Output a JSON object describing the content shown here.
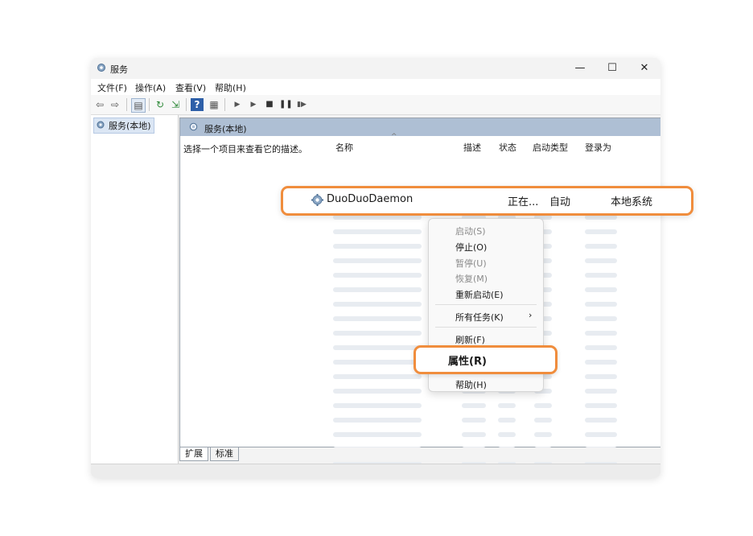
{
  "window": {
    "title": "服务",
    "minimize": "—",
    "maximize": "☐",
    "close": "✕"
  },
  "menu": [
    "文件(F)",
    "操作(A)",
    "查看(V)",
    "帮助(H)"
  ],
  "tree": {
    "item": "服务(本地)"
  },
  "pane": {
    "header": "服务(本地)",
    "description_hint": "选择一个项目来查看它的描述。",
    "columns": [
      "名称",
      "描述",
      "状态",
      "启动类型",
      "登录为"
    ]
  },
  "highlighted_service": {
    "name": "DuoDuoDaemon",
    "status": "正在...",
    "startup": "自动",
    "logon": "本地系统"
  },
  "context_menu": {
    "start": "启动(S)",
    "stop": "停止(O)",
    "pause": "暂停(U)",
    "resume": "恢复(M)",
    "restart": "重新启动(E)",
    "all_tasks": "所有任务(K)",
    "all_tasks_arrow": "›",
    "refresh": "刷新(F)",
    "properties": "属性(R)",
    "help": "帮助(H)"
  },
  "tabs": [
    "扩展",
    "标准"
  ],
  "toolbar_icons": [
    "back-arrow-icon",
    "forward-arrow-icon",
    "show-hide-tree-icon",
    "refresh-icon",
    "export-icon",
    "help-icon",
    "properties-icon",
    "play-icon",
    "play-alt-icon",
    "stop-icon",
    "pause-icon",
    "restart-icon"
  ],
  "colors": {
    "accent_highlight": "#f08d3d",
    "pane_header": "#aebfd4"
  }
}
